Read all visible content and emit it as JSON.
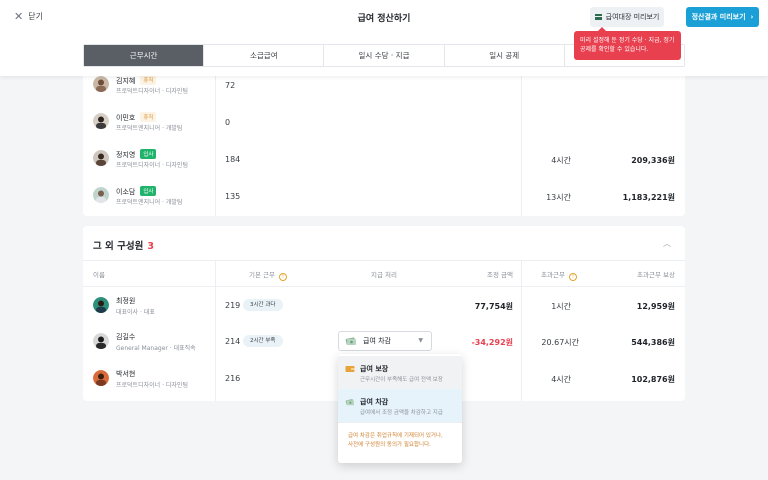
{
  "header": {
    "close_label": "닫기",
    "title": "급여 정산하기",
    "preview_ledger_label": "급여대장 미리보기",
    "preview_result_label": "정산결과 미리보기"
  },
  "tooltip": {
    "line1": "미리 설정해 둔 정기 수당 · 지급, 정기",
    "line2": "공제를 확인할 수 있습니다."
  },
  "tabs": [
    {
      "label": "근무시간",
      "active": true
    },
    {
      "label": "소급급여",
      "active": false
    },
    {
      "label": "일시 수당 · 지급",
      "active": false
    },
    {
      "label": "일시 공제",
      "active": false
    },
    {
      "label": "",
      "active": false
    }
  ],
  "card1": {
    "rows": [
      {
        "name": "김지혜",
        "badge": "휴직",
        "badge_type": "leave",
        "role": "프로덕트디자이너 · 디자인팀",
        "base": "72",
        "overtime": "",
        "pay": ""
      },
      {
        "name": "이민호",
        "badge": "휴직",
        "badge_type": "leave",
        "role": "프로덕트엔지니어 · 개발팀",
        "base": "0",
        "overtime": "",
        "pay": ""
      },
      {
        "name": "정지영",
        "badge": "입사",
        "badge_type": "join",
        "role": "프로덕트디자이너 · 디자인팀",
        "base": "184",
        "overtime": "4시간",
        "pay": "209,336원"
      },
      {
        "name": "이소담",
        "badge": "입사",
        "badge_type": "join",
        "role": "프로덕트엔지니어 · 개발팀",
        "base": "135",
        "overtime": "13시간",
        "pay": "1,183,221원"
      }
    ]
  },
  "card2": {
    "title": "그 외 구성원",
    "count": "3",
    "headers": {
      "name": "이름",
      "base": "기본 근무",
      "pay_process": "지급 처리",
      "adjust": "조정 금액",
      "overtime": "초과근무",
      "overtime_pay": "초과근무 보상"
    },
    "rows": [
      {
        "name": "최정원",
        "role": "대표이사 · 대표",
        "base": "219",
        "pill": "3시간 과다",
        "adjust": "77,754원",
        "overtime": "1시간",
        "overtime_pay": "12,959원"
      },
      {
        "name": "김길수",
        "role": "General Manager · 대표직속",
        "base": "214",
        "pill": "2시간 부족",
        "adjust": "-34,292원",
        "overtime": "20.67시간",
        "overtime_pay": "544,386원"
      },
      {
        "name": "박서현",
        "role": "프로덕트디자이너 · 디자인팀",
        "base": "216",
        "pill": "",
        "adjust": "",
        "overtime": "4시간",
        "overtime_pay": "102,876원"
      }
    ]
  },
  "select": {
    "value": "급여 차감"
  },
  "dropdown": {
    "options": [
      {
        "title": "급여 보장",
        "desc": "근무시간이 부족해도 급여 전액 보장",
        "icon": "wallet-icon"
      },
      {
        "title": "급여 차감",
        "desc": "급여에서 조정 금액을 차감하고 지급",
        "icon": "money-minus-icon"
      }
    ],
    "note_line1": "급여 차감은 취업규칙에 기재되어 있거나,",
    "note_line2": "사전에 구성원의 동의가 필요합니다."
  },
  "colors": {
    "accent_blue": "#1a9fd6",
    "danger_red": "#e8404f",
    "join_green": "#20b36b",
    "leave_orange": "#d99a3c",
    "active_tab": "#5a5f66"
  }
}
